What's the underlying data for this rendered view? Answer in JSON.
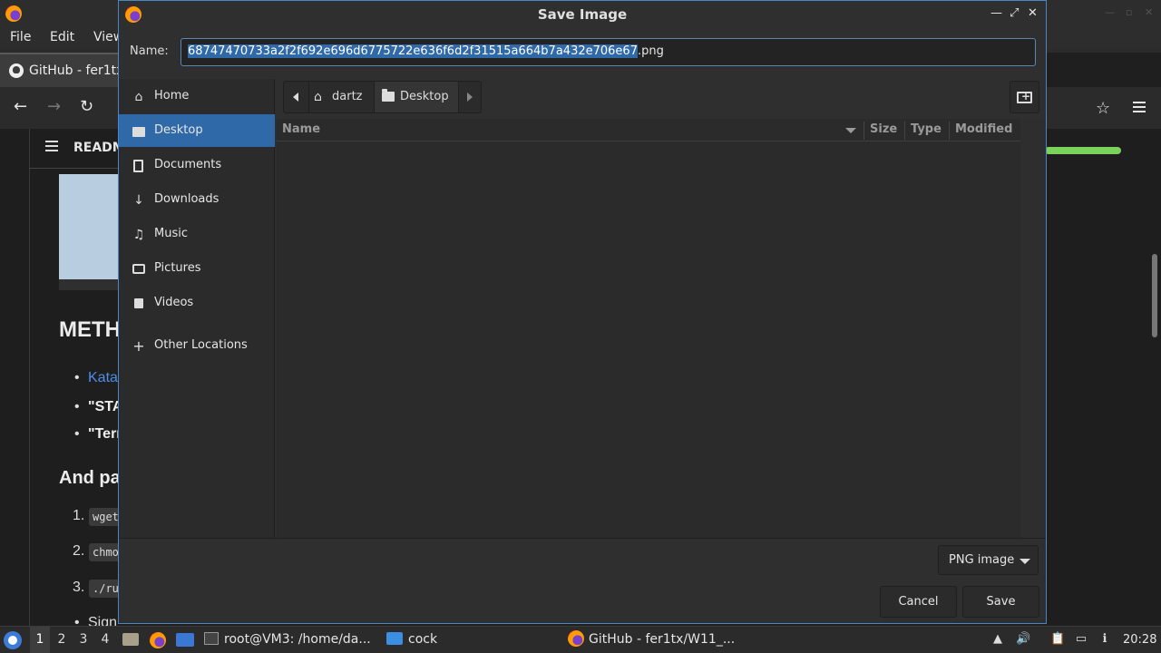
{
  "browser": {
    "menu": [
      "File",
      "Edit",
      "View"
    ],
    "tab_title": "GitHub - fer1tx",
    "readme_label": "READM",
    "page": {
      "heading1": "METH",
      "li1": "Kata",
      "li2": "\"STA",
      "li3": "\"Terr",
      "heading2": "And pa",
      "ol1_num": "1.",
      "ol1_code": "wget",
      "ol2_num": "2.",
      "ol2_code": "chmo",
      "ol3_num": "3.",
      "ol3_code": "./ru",
      "last_li": "Sign"
    }
  },
  "dialog": {
    "title": "Save Image",
    "name_label": "Name:",
    "name_selected": "68747470733a2f2f692e696d6775722e636f6d2f31515a664b7a432e706e67",
    "name_extension": ".png",
    "sidebar": [
      {
        "label": "Home",
        "icon": "home-icon"
      },
      {
        "label": "Desktop",
        "icon": "desktop-icon",
        "active": true
      },
      {
        "label": "Documents",
        "icon": "document-icon"
      },
      {
        "label": "Downloads",
        "icon": "download-icon"
      },
      {
        "label": "Music",
        "icon": "music-icon"
      },
      {
        "label": "Pictures",
        "icon": "camera-icon"
      },
      {
        "label": "Videos",
        "icon": "video-icon"
      },
      {
        "label": "Other Locations",
        "icon": "plus-icon"
      }
    ],
    "path": [
      "dartz",
      "Desktop"
    ],
    "columns": [
      "Name",
      "Size",
      "Type",
      "Modified"
    ],
    "file_type": "PNG image",
    "cancel_label": "Cancel",
    "save_label": "Save"
  },
  "taskbar": {
    "workspaces": [
      "1",
      "2",
      "3",
      "4"
    ],
    "active_workspace": "1",
    "items": [
      "root@VM3: /home/da...",
      "cock",
      "GitHub - fer1tx/W11_..."
    ],
    "clock": "20:28"
  },
  "colors": {
    "accent": "#2f69a8",
    "dialog_border": "#4a86c6",
    "progress_green": "#7cd35b"
  }
}
